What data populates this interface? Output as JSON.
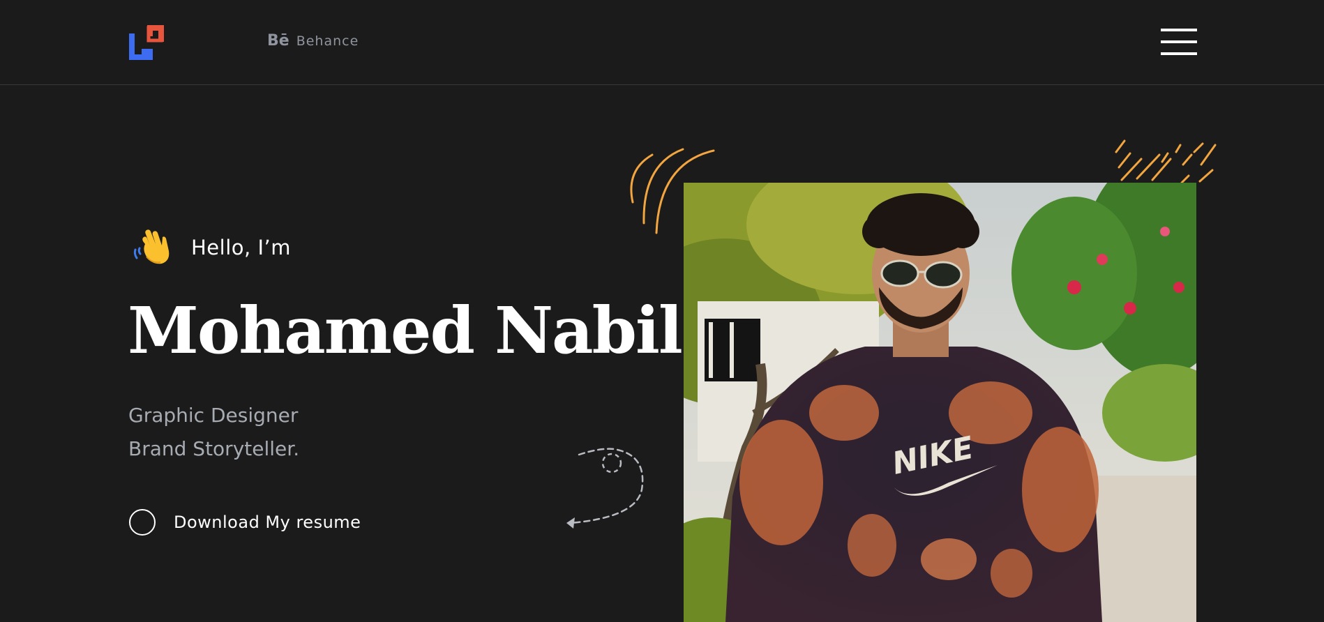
{
  "header": {
    "logo": {
      "icon": "brand-logo-icon",
      "colors": {
        "primary": "#3d6cf0",
        "secondary": "#e8553d"
      }
    },
    "behance": {
      "icon_label": "Bē",
      "label": "Behance"
    },
    "menu_icon": "hamburger-menu-icon"
  },
  "hero": {
    "greeting_icon": "waving-hand-icon",
    "greeting": "Hello, I’m",
    "name": "Mohamed Nabil",
    "roles": [
      "Graphic Designer",
      "Brand Storyteller."
    ],
    "cta_label": "Download My resume"
  },
  "decorations": {
    "accent_color": "#f3a640",
    "arrow_color": "#b9bcc2"
  },
  "photo": {
    "subject": "portrait-photo"
  }
}
